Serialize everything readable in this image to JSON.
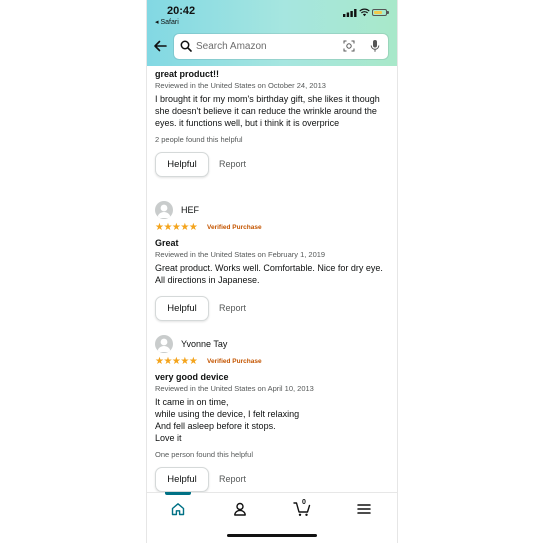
{
  "status_bar": {
    "time": "20:42",
    "back_app": "◂ Safari"
  },
  "search": {
    "placeholder": "Search Amazon"
  },
  "colors": {
    "accent": "#007185",
    "star": "#F4A41C",
    "verified": "#C45500",
    "header_start": "#82d8e3",
    "header_end": "#a8e8c9"
  },
  "reviews": [
    {
      "name": "",
      "stars": "",
      "verified": "",
      "title": "great product!!",
      "meta": "Reviewed in the United States on October 24, 2013",
      "body": "I brought it for my mom's birthday gift, she likes it though she doesn't believe it can reduce the wrinkle around the eyes. it functions well, but i think it is overprice",
      "helpful_count": "2 people found this helpful",
      "helpful_label": "Helpful",
      "report_label": "Report"
    },
    {
      "name": "HEF",
      "stars": "★★★★★",
      "rating": 5,
      "verified": "Verified Purchase",
      "title": "Great",
      "meta": "Reviewed in the United States on February 1, 2019",
      "body": "Great product. Works well. Comfortable. Nice for dry eye. All directions in Japanese.",
      "helpful_count": "",
      "helpful_label": "Helpful",
      "report_label": "Report"
    },
    {
      "name": "Yvonne Tay",
      "stars": "★★★★★",
      "rating": 5,
      "verified": "Verified Purchase",
      "title": "very good device",
      "meta": "Reviewed in the United States on April 10, 2013",
      "body": "It came in on time,\nwhile using the device, I felt relaxing\nAnd fell asleep before it stops.\nLove it",
      "helpful_count": "One person found this helpful",
      "helpful_label": "Helpful",
      "report_label": "Report"
    }
  ],
  "bottom_nav": {
    "items": [
      {
        "icon": "home-icon",
        "active": true
      },
      {
        "icon": "account-icon",
        "active": false
      },
      {
        "icon": "cart-icon",
        "active": false
      },
      {
        "icon": "menu-icon",
        "active": false
      }
    ],
    "cart_count": "0"
  }
}
